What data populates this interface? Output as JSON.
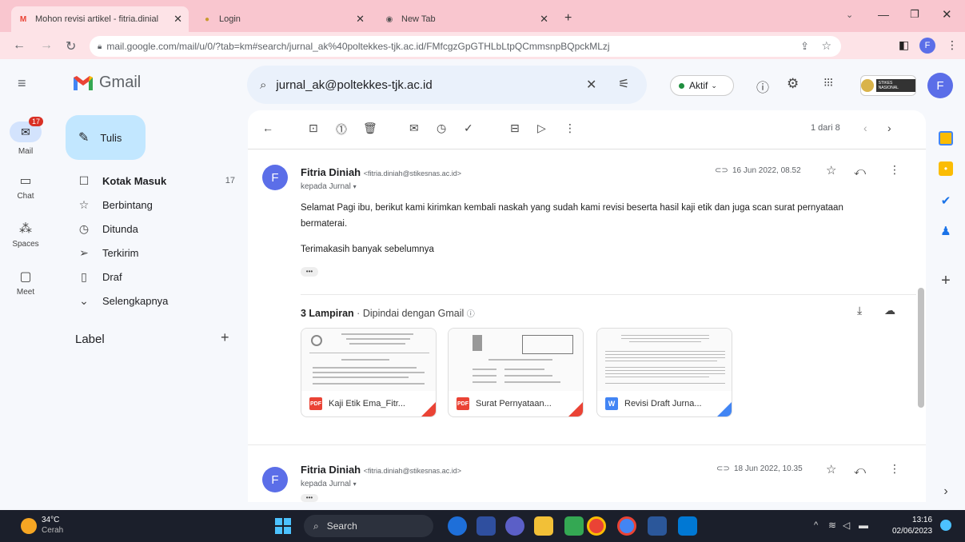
{
  "browser": {
    "tabs": [
      {
        "title": "Mohon revisi artikel - fitria.dinial",
        "icon": "gmail-icon"
      },
      {
        "title": "Login",
        "icon": "login-icon"
      },
      {
        "title": "New Tab",
        "icon": "chrome-icon"
      }
    ],
    "url": "mail.google.com/mail/u/0/?tab=km#search/jurnal_ak%40poltekkes-tjk.ac.id/FMfcgzGpGTHLbLtpQCmmsnpBQpckMLzj",
    "profile_initial": "F"
  },
  "gmail": {
    "logo_text": "Gmail",
    "search_value": "jurnal_ak@poltekkes-tjk.ac.id",
    "status_label": "Aktif",
    "org_badge": "STIKES NASIONAL",
    "account_initial": "F"
  },
  "rail": {
    "mail_badge": "17",
    "items": [
      "Mail",
      "Chat",
      "Spaces",
      "Meet"
    ]
  },
  "sidebar": {
    "compose_label": "Tulis",
    "items": [
      {
        "label": "Kotak Masuk",
        "count": "17"
      },
      {
        "label": "Berbintang",
        "count": ""
      },
      {
        "label": "Ditunda",
        "count": ""
      },
      {
        "label": "Terkirim",
        "count": ""
      },
      {
        "label": "Draf",
        "count": ""
      },
      {
        "label": "Selengkapnya",
        "count": ""
      }
    ],
    "label_heading": "Label",
    "label_add": "+"
  },
  "toolbar": {
    "pagination": "1 dari 8"
  },
  "messages": [
    {
      "initial": "F",
      "sender": "Fitria Diniah",
      "email": "<fitria.diniah@stikesnas.ac.id>",
      "recipient": "kepada Jurnal",
      "date": "16 Jun 2022, 08.52",
      "body1": "Selamat Pagi ibu, berikut kami kirimkan kembali naskah yang sudah kami revisi beserta hasil kaji etik dan juga scan surat pernyataan bermaterai.",
      "body2": "Terimakasih banyak sebelumnya",
      "more": "•••"
    },
    {
      "initial": "F",
      "sender": "Fitria Diniah",
      "email": "<fitria.diniah@stikesnas.ac.id>",
      "recipient": "kepada Jurnal",
      "date": "18 Jun 2022, 10.35",
      "more": "•••"
    }
  ],
  "attachments": {
    "count_label": "3 Lampiran",
    "scan_label": "Dipindai dengan Gmail",
    "files": [
      {
        "name": "Kaji Etik Ema_Fitr...",
        "type": "PDF",
        "color": "#ea4335"
      },
      {
        "name": "Surat Pernyataan...",
        "type": "PDF",
        "color": "#ea4335"
      },
      {
        "name": "Revisi Draft Jurna...",
        "type": "W",
        "color": "#4285f4"
      }
    ]
  },
  "taskbar": {
    "temperature": "34°C",
    "weather": "Cerah",
    "search_label": "Search",
    "time": "13:16",
    "date": "02/06/2023"
  }
}
